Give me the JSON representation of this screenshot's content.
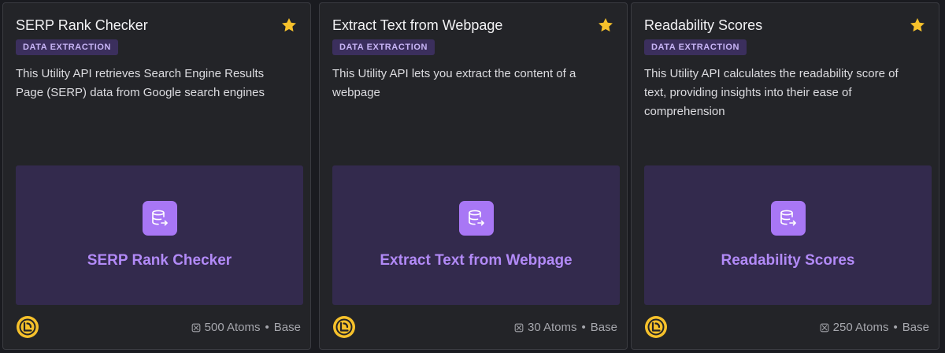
{
  "cards": [
    {
      "title": "SERP Rank Checker",
      "badge": "DATA EXTRACTION",
      "description": "This Utility API retrieves Search Engine Results Page (SERP) data from Google search engines",
      "preview_label": "SERP Rank Checker",
      "atoms": "500 Atoms",
      "separator": "•",
      "tier": "Base"
    },
    {
      "title": "Extract Text from Webpage",
      "badge": "DATA EXTRACTION",
      "description": "This Utility API lets you extract the content of a webpage",
      "preview_label": "Extract Text from Webpage",
      "atoms": "30 Atoms",
      "separator": "•",
      "tier": "Base"
    },
    {
      "title": "Readability Scores",
      "badge": "DATA EXTRACTION",
      "description": "This Utility API calculates the readability score of text, providing insights into their ease of comprehension",
      "preview_label": "Readability Scores",
      "atoms": "250 Atoms",
      "separator": "•",
      "tier": "Base"
    }
  ],
  "icons": {
    "favorite": "star-icon",
    "category": "database-export-icon",
    "brand": "logo-icon",
    "cost": "atom-icon"
  },
  "colors": {
    "card_bg": "#232428",
    "accent": "#a877f5",
    "badge_bg": "#3b2f5d",
    "star": "#f6c12b"
  }
}
